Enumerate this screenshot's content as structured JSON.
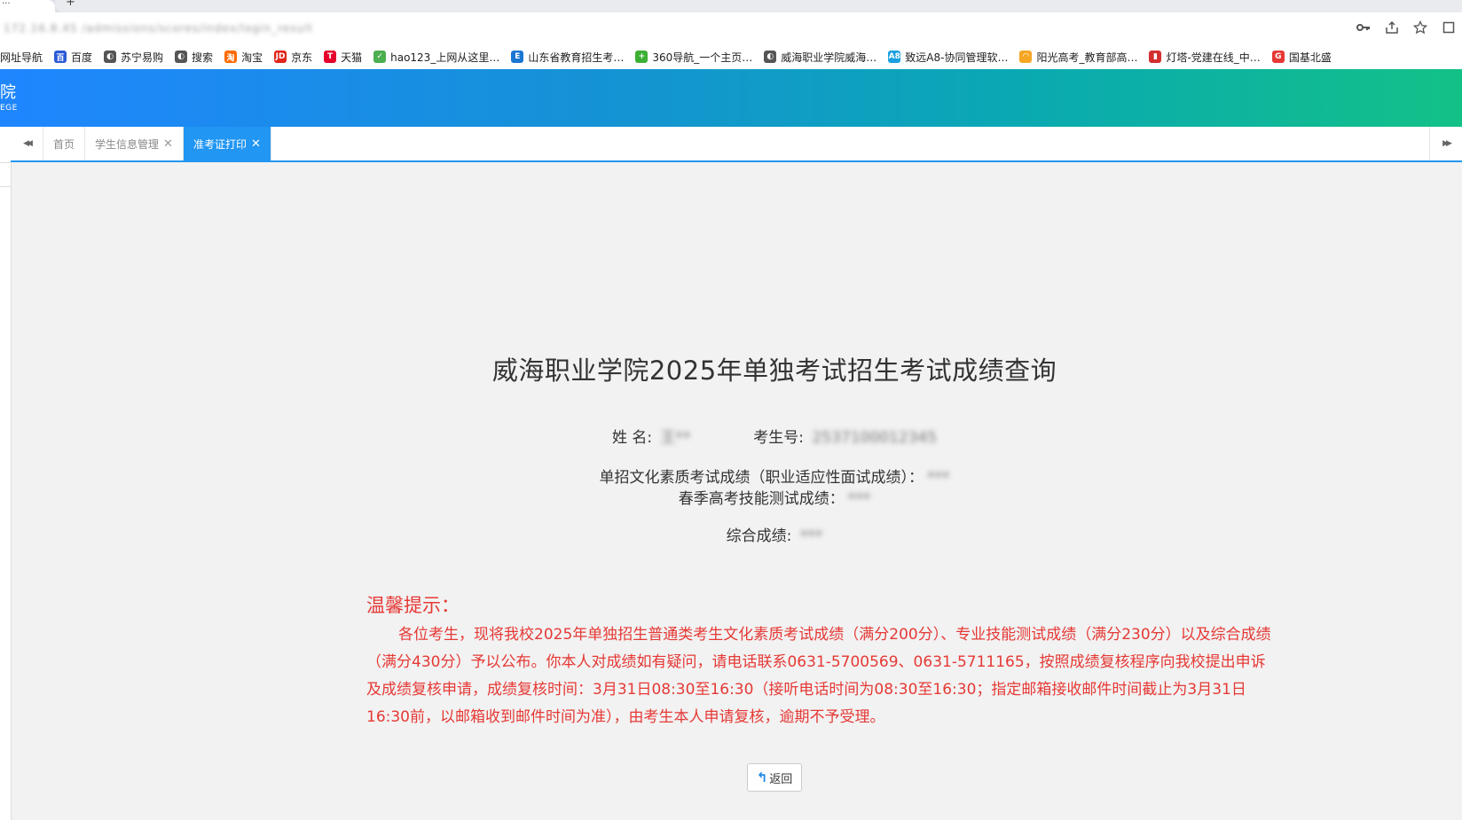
{
  "browser": {
    "tab_title": "...",
    "new_tab": "+",
    "url": "172.16.8.45 /admissions/scores/index/login_result",
    "icons": [
      "key-icon",
      "share-icon",
      "star-icon",
      "window-icon"
    ],
    "bookmarks": [
      {
        "label": "网址导航",
        "icon": "",
        "color": "#2f6fd6"
      },
      {
        "label": "百度",
        "icon": "百",
        "color": "#2a5bd7"
      },
      {
        "label": "苏宁易购",
        "icon": "◐",
        "color": "#555555"
      },
      {
        "label": "搜索",
        "icon": "◐",
        "color": "#555555"
      },
      {
        "label": "淘宝",
        "icon": "淘",
        "color": "#ff6a00"
      },
      {
        "label": "京东",
        "icon": "JD",
        "color": "#e1251b"
      },
      {
        "label": "天猫",
        "icon": "T",
        "color": "#e4002b"
      },
      {
        "label": "hao123_上网从这里…",
        "icon": "✓",
        "color": "#4caf50"
      },
      {
        "label": "山东省教育招生考…",
        "icon": "E",
        "color": "#1976d2"
      },
      {
        "label": "360导航_一个主页…",
        "icon": "+",
        "color": "#3cb034"
      },
      {
        "label": "威海职业学院威海…",
        "icon": "◐",
        "color": "#555555"
      },
      {
        "label": "致远A8-协同管理软…",
        "icon": "A8",
        "color": "#1aa0e0"
      },
      {
        "label": "阳光高考_教育部高…",
        "icon": "◠",
        "color": "#f5a623"
      },
      {
        "label": "灯塔-党建在线_中…",
        "icon": "▮",
        "color": "#d32f2f"
      },
      {
        "label": "国基北盛",
        "icon": "G",
        "color": "#e53935"
      }
    ]
  },
  "header": {
    "logo_cn": "院",
    "logo_en": "EGE"
  },
  "tabbar": {
    "prev_icon": "◀◀",
    "next_icon": "▶▶",
    "tabs": [
      {
        "label": "首页",
        "closable": false,
        "active": false
      },
      {
        "label": "学生信息管理",
        "closable": true,
        "active": false
      },
      {
        "label": "准考证打印",
        "closable": true,
        "active": true
      }
    ],
    "close_glyph": "✕"
  },
  "main": {
    "title": "威海职业学院2025年单独考试招生考试成绩查询",
    "name_label": "姓 名:",
    "name_value": "王**",
    "exam_no_label": "考生号:",
    "exam_no_value": "2537100012345",
    "score1_label": "单招文化素质考试成绩（职业适应性面试成绩）：",
    "score1_value": "***",
    "score2_label": "春季高考技能测试成绩：",
    "score2_value": "***",
    "score3_label": "综合成绩:",
    "score3_value": "***",
    "notice_title": "温馨提示：",
    "notice_body": "各位考生，现将我校2025年单独招生普通类考生文化素质考试成绩（满分200分）、专业技能测试成绩（满分230分）以及综合成绩（满分430分）予以公布。你本人对成绩如有疑问，请电话联系0631-5700569、0631-5711165，按照成绩复核程序向我校提出申诉及成绩复核申请，成绩复核时间：3月31日08:30至16:30（接听电话时间为08:30至16:30；指定邮箱接收邮件时间截止为3月31日16:30前，以邮箱收到邮件时间为准），由考生本人申请复核，逾期不予受理。",
    "back_label": "返回",
    "back_icon": "↰"
  }
}
